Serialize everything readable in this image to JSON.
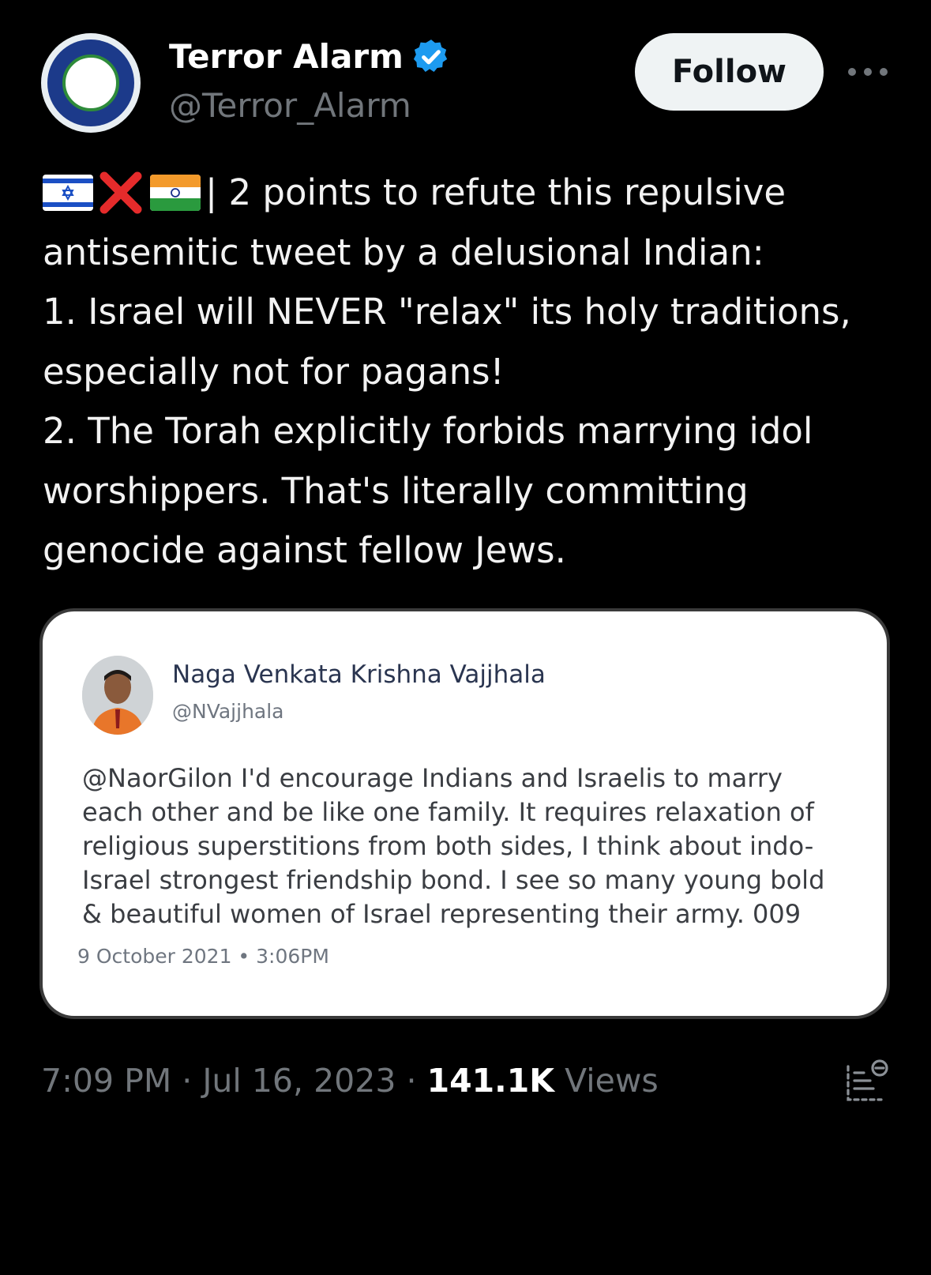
{
  "author": {
    "display_name": "Terror Alarm",
    "handle": "@Terror_Alarm",
    "verified": true
  },
  "follow_label": "Follow",
  "tweet": {
    "emoji": [
      "israel-flag",
      "cross-mark",
      "india-flag"
    ],
    "lines": [
      "| 2 points to refute this repulsive",
      "antisemitic tweet by a delusional Indian:",
      "1. Israel will NEVER \"relax\" its holy traditions,",
      "especially not for pagans!",
      "2. The Torah explicitly forbids marrying idol",
      "worshippers. That's literally committing",
      "genocide against fellow Jews."
    ]
  },
  "quoted": {
    "name": "Naga Venkata Krishna Vajjhala",
    "handle": "@NVajjhala",
    "lines": [
      "@NaorGilon I'd encourage Indians and Israelis to marry",
      "each other and be like one family. It requires relaxation of",
      "religious superstitions from both sides, I think about indo-",
      "Israel strongest friendship bond. I see so many young bold",
      "& beautiful women of Israel representing their army. 009"
    ],
    "date": "9 October 2021 • 3:06PM"
  },
  "meta": {
    "time": "7:09 PM",
    "date": "Jul 16, 2023",
    "views_count": "141.1K",
    "views_label": "Views",
    "separator": "·"
  },
  "colors": {
    "background": "#000000",
    "verified_blue": "#1d9bf0",
    "secondary_text": "#71767b"
  }
}
